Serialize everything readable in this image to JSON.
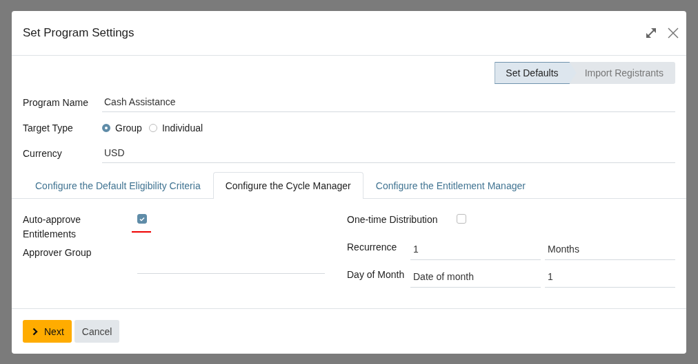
{
  "dialog": {
    "title": "Set Program Settings"
  },
  "steps": [
    {
      "label": "Set Defaults",
      "selected": true
    },
    {
      "label": "Import Registrants",
      "selected": false
    }
  ],
  "fields": [
    {
      "kind": "text",
      "label": "Program Name",
      "value": "Cash Assistance"
    },
    {
      "kind": "radio",
      "label": "Target Type",
      "options": [
        {
          "label": "Group",
          "selected": true
        },
        {
          "label": "Individual",
          "selected": false
        }
      ]
    },
    {
      "kind": "text",
      "label": "Currency",
      "value": "USD"
    }
  ],
  "tabs": [
    {
      "label": "Configure the Default Eligibility Criteria",
      "selected": false
    },
    {
      "label": "Configure the Cycle Manager",
      "selected": true
    },
    {
      "label": "Configure the Entitlement Manager",
      "selected": false
    }
  ],
  "left_fields": [
    {
      "kind": "checkbox",
      "label": "Auto-approve Entitlements",
      "checked": true
    },
    {
      "kind": "text",
      "label": "Approver Group"
    }
  ],
  "right_fields": [
    {
      "kind": "checkbox",
      "label": "One-time Distribution",
      "checked": false
    },
    {
      "kind": "pair",
      "label": "Recurrence",
      "values": [
        "1",
        "Months"
      ]
    },
    {
      "kind": "pair",
      "label": "Day of Month",
      "values": [
        "Date of month",
        "1"
      ]
    }
  ],
  "buttons": [
    {
      "label": "Next",
      "kind": "primary"
    },
    {
      "label": "Cancel",
      "kind": "secondary"
    }
  ]
}
